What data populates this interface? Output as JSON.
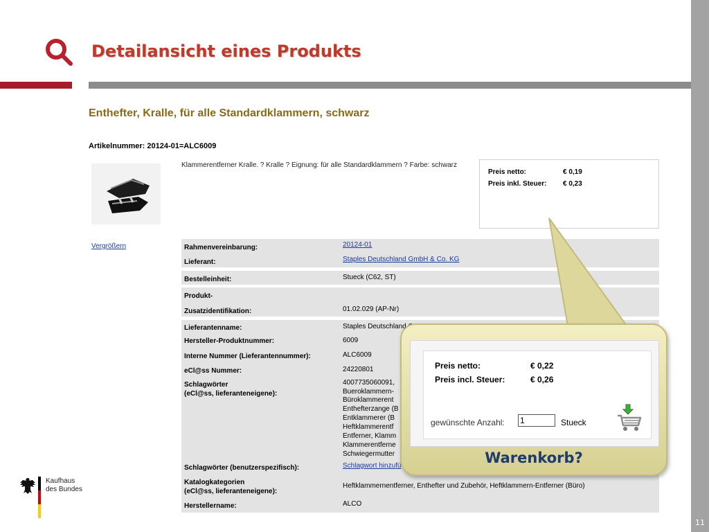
{
  "slide": {
    "title": "Detailansicht eines Produkts",
    "number": "11"
  },
  "product": {
    "title": "Enthefter, Kralle, für alle Standardklammern, schwarz",
    "article_number": "Artikelnummer: 20124-01=ALC6009",
    "description": "Klammerentferner Kralle. ? Kralle ? Eignung: für alle Standardklammern ? Farbe: schwarz",
    "enlarge_link": "Vergrößern",
    "prices": [
      {
        "label": "Preis netto:",
        "value": "€ 0,19"
      },
      {
        "label": "Preis inkl. Steuer:",
        "value": "€ 0,23"
      }
    ]
  },
  "details": [
    {
      "label": "Rahmenvereinbarung:",
      "value": "20124-01",
      "link": true
    },
    {
      "label": "Lieferant:",
      "value": "Staples Deutschland GmbH & Co. KG",
      "link": true
    },
    {
      "label": "Bestelleinheit:",
      "value": "Stueck (C62, ST)"
    },
    {
      "label": "Produkt-",
      "value": ""
    },
    {
      "label": "Zusatzidentifikation:",
      "value": "01.02.029 (AP-Nr)"
    },
    {
      "label": "Lieferantenname:",
      "value": "Staples Deutschland G"
    },
    {
      "label": "Hersteller-Produktnummer:",
      "value": "6009"
    },
    {
      "label": "Interne Nummer (Lieferantennummer):",
      "value": "ALC6009"
    },
    {
      "label": "eCl@ss Nummer:",
      "value": "24220801"
    },
    {
      "label": "Schlagwörter",
      "value": "4007735060091,"
    },
    {
      "label": "(eCl@ss, lieferanteneigene):",
      "value": "Bueroklammern-"
    },
    {
      "label": "",
      "value": "Büroklammerent"
    },
    {
      "label": "",
      "value": "Enthefterzange (B"
    },
    {
      "label": "",
      "value": "Entklammerer (B"
    },
    {
      "label": "",
      "value": "Heftklammerentf"
    },
    {
      "label": "",
      "value": "Entferner, Klamm"
    },
    {
      "label": "",
      "value": "Klammerentferne"
    },
    {
      "label": "",
      "value": "Schwiegermutter"
    },
    {
      "label": "Schlagwörter (benutzerspezifisch):",
      "value": "Schlagwort hinzufü",
      "link": true
    },
    {
      "label": "Katalogkategorien",
      "value": ""
    },
    {
      "label": "(eCl@ss, lieferanteneigene):",
      "value": "Heftklammernentferner, Enthefter und Zubehör, Heftklammern-Entferner (Büro)"
    },
    {
      "label": "Herstellername:",
      "value": "ALCO"
    }
  ],
  "bubble": {
    "prices": [
      {
        "label": "Preis netto:",
        "value": "€ 0,22"
      },
      {
        "label": "Preis incl. Steuer:",
        "value": "€ 0,26"
      }
    ],
    "quantity_label": "gewünschte Anzahl:",
    "quantity_value": "1",
    "quantity_unit": "Stueck",
    "caption": "Warenkorb?"
  },
  "logo": {
    "line1": "Kaufhaus",
    "line2": "des Bundes"
  },
  "colors": {
    "title_red": "#c0392b",
    "product_title_brown": "#8b6a10",
    "link_blue": "#1a3a9a",
    "caption_blue": "#1f3a6d"
  }
}
